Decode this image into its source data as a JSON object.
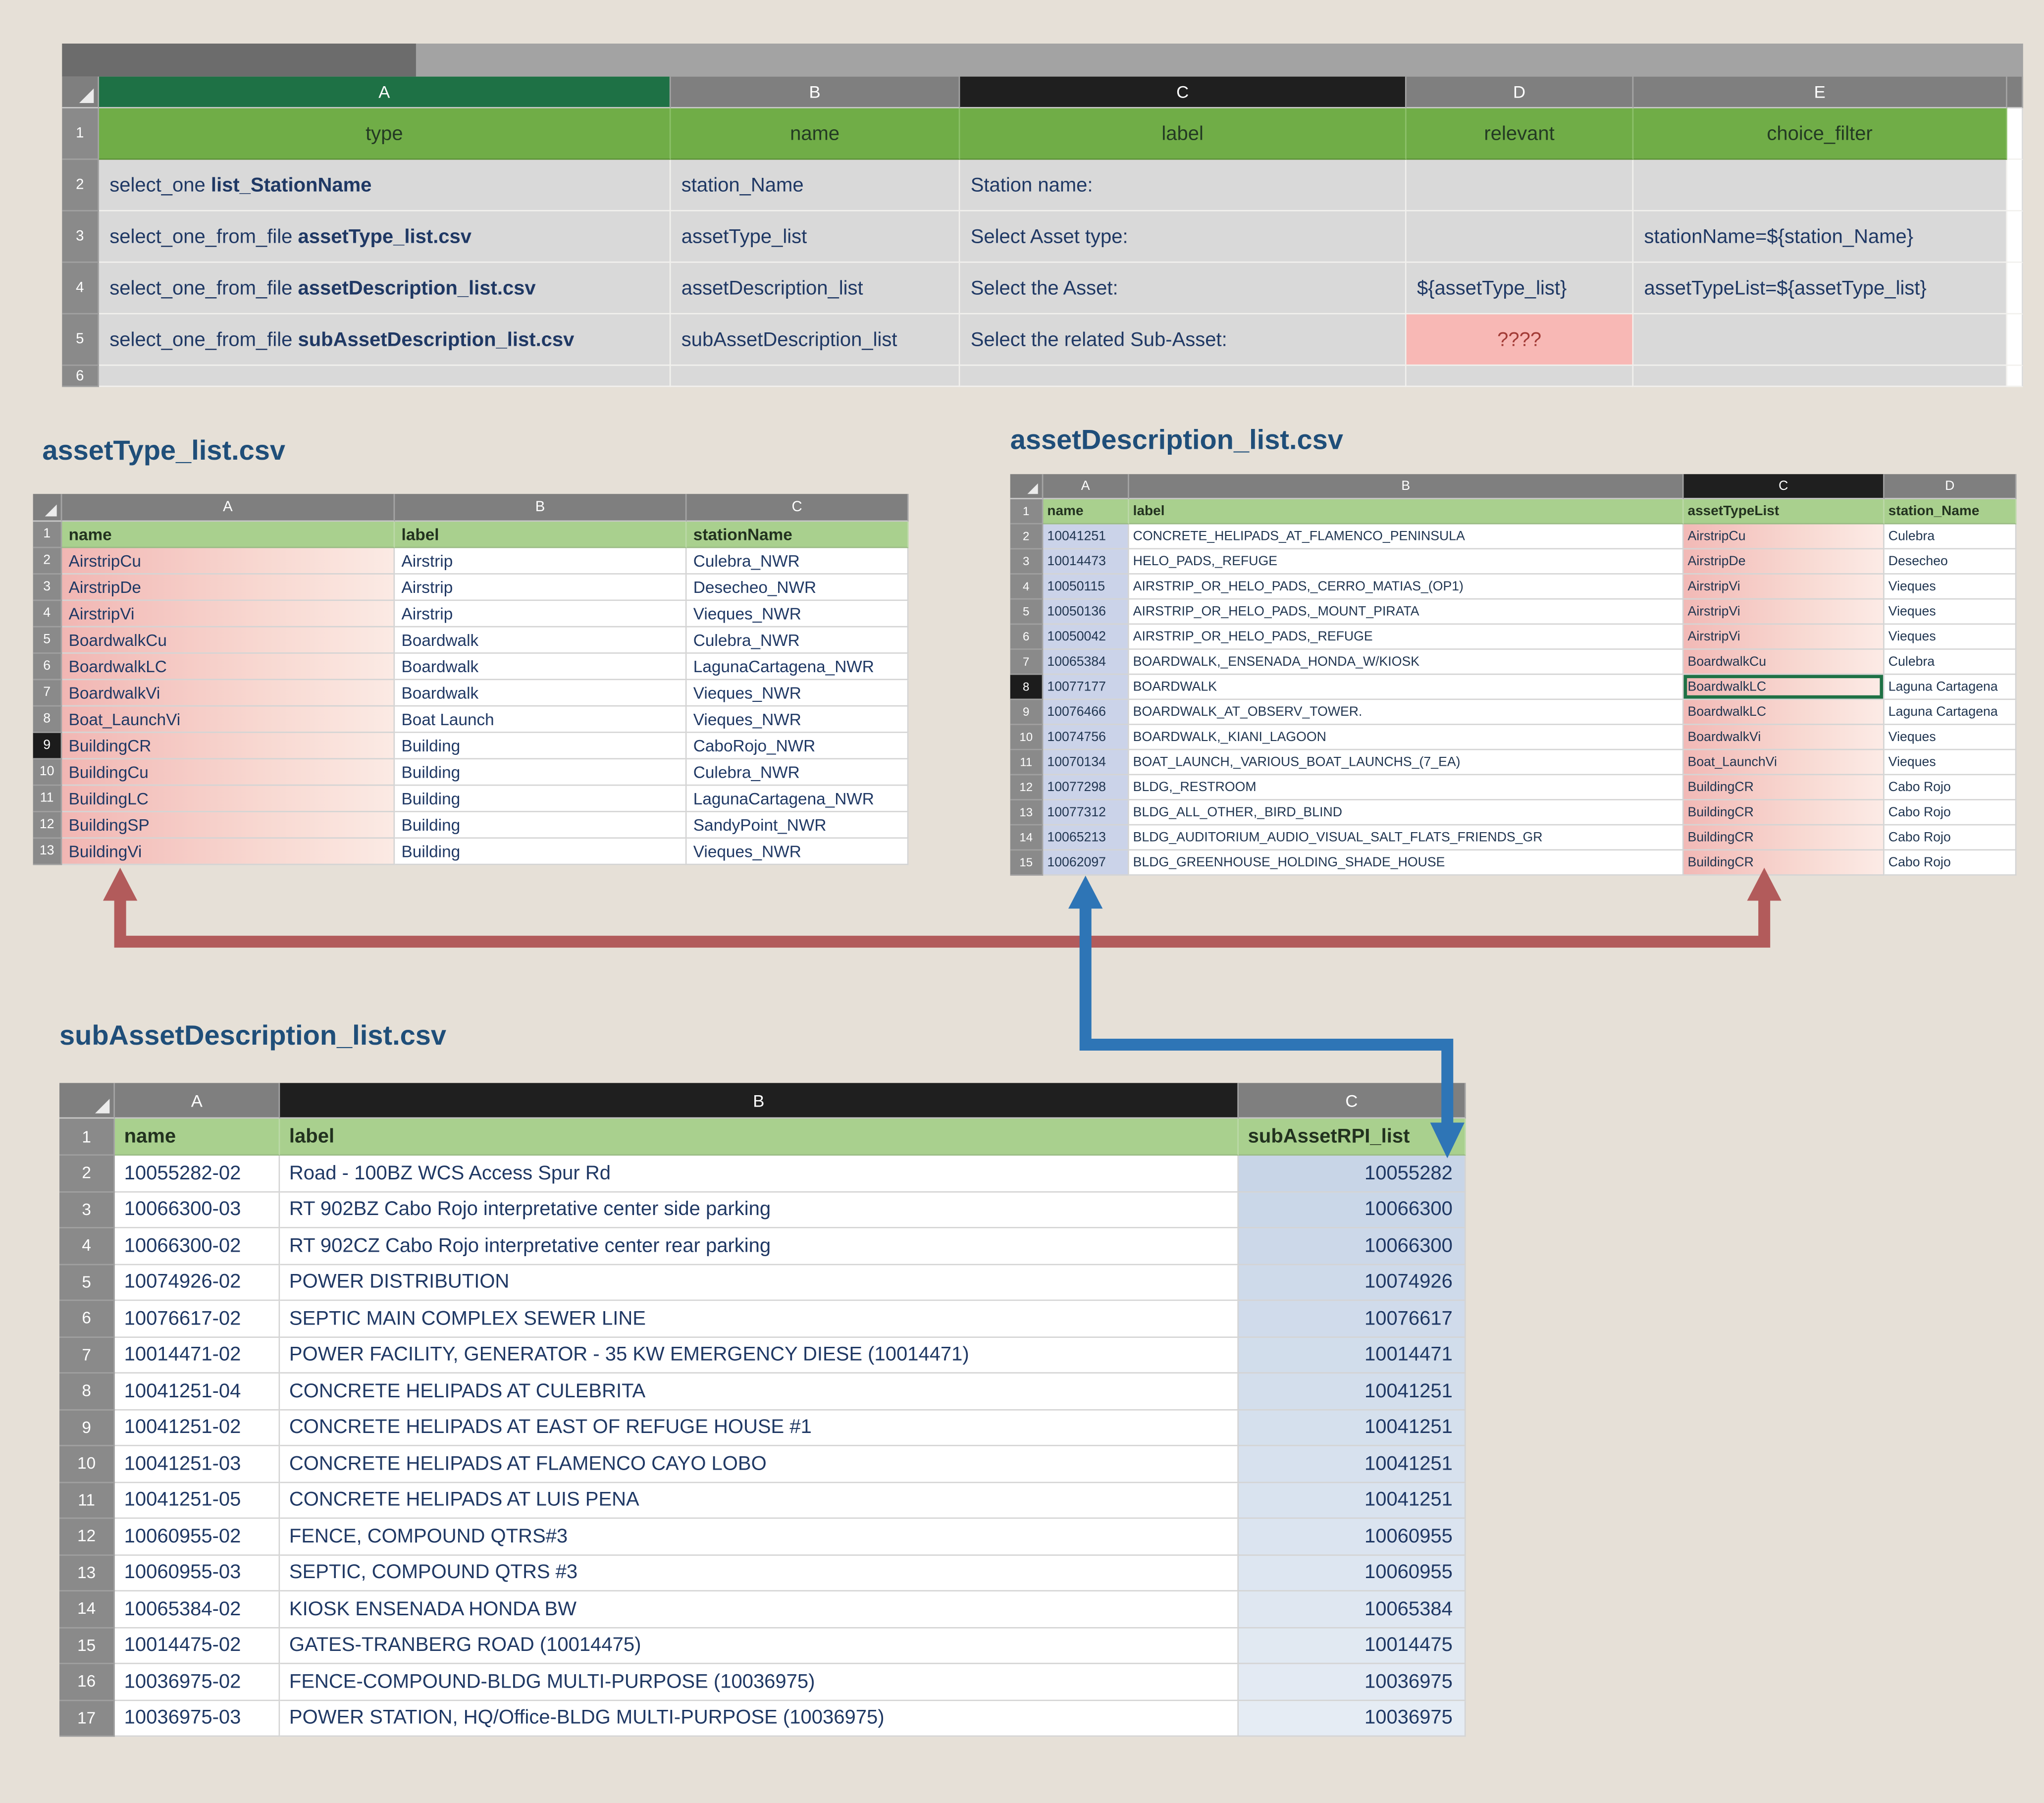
{
  "colors": {
    "survey_header_green": "#70ad47",
    "csv_header_green": "#a9d08e",
    "pink_highlight": "#f2b9b6",
    "lavender_highlight": "#cbd3e9",
    "blue_column_tint": "#ccd6e8",
    "red_arrow": "#b25b5b",
    "blue_arrow": "#2e75b6",
    "error_cell_bg": "#f8b8b5"
  },
  "survey": {
    "column_letters": [
      "A",
      "B",
      "C",
      "D",
      "E"
    ],
    "row1_num": "1",
    "headers": [
      "type",
      "name",
      "label",
      "relevant",
      "choice_filter"
    ],
    "rows": [
      {
        "num": "2",
        "type_prefix": "select_one ",
        "type_file": "list_StationName",
        "name": "station_Name",
        "label": "Station name:",
        "relevant": "",
        "choice_filter": ""
      },
      {
        "num": "3",
        "type_prefix": "select_one_from_file ",
        "type_file": "assetType_list.csv",
        "name": "assetType_list",
        "label": "Select Asset type:",
        "relevant": "",
        "choice_filter": "stationName=${station_Name}"
      },
      {
        "num": "4",
        "type_prefix": "select_one_from_file ",
        "type_file": "assetDescription_list.csv",
        "name": "assetDescription_list",
        "label": "Select the Asset:",
        "relevant": "${assetType_list}",
        "choice_filter": "assetTypeList=${assetType_list}"
      },
      {
        "num": "5",
        "type_prefix": "select_one_from_file ",
        "type_file": "subAssetDescription_list.csv",
        "name": "subAssetDescription_list",
        "label": "Select the related Sub-Asset:",
        "relevant": "????",
        "choice_filter": ""
      }
    ],
    "empty_row_num": "6"
  },
  "asset_type_table": {
    "title": "assetType_list.csv",
    "column_letters": [
      "A",
      "B",
      "C"
    ],
    "row1_num": "1",
    "headers": [
      "name",
      "label",
      "stationName"
    ],
    "selected_row": "9",
    "rows": [
      {
        "num": "2",
        "name": "AirstripCu",
        "label": "Airstrip",
        "station": "Culebra_NWR"
      },
      {
        "num": "3",
        "name": "AirstripDe",
        "label": "Airstrip",
        "station": "Desecheo_NWR"
      },
      {
        "num": "4",
        "name": "AirstripVi",
        "label": "Airstrip",
        "station": "Vieques_NWR"
      },
      {
        "num": "5",
        "name": "BoardwalkCu",
        "label": "Boardwalk",
        "station": "Culebra_NWR"
      },
      {
        "num": "6",
        "name": "BoardwalkLC",
        "label": "Boardwalk",
        "station": "LagunaCartagena_NWR"
      },
      {
        "num": "7",
        "name": "BoardwalkVi",
        "label": "Boardwalk",
        "station": "Vieques_NWR"
      },
      {
        "num": "8",
        "name": "Boat_LaunchVi",
        "label": "Boat Launch",
        "station": "Vieques_NWR"
      },
      {
        "num": "9",
        "name": "BuildingCR",
        "label": "Building",
        "station": "CaboRojo_NWR"
      },
      {
        "num": "10",
        "name": "BuildingCu",
        "label": "Building",
        "station": "Culebra_NWR"
      },
      {
        "num": "11",
        "name": "BuildingLC",
        "label": "Building",
        "station": "LagunaCartagena_NWR"
      },
      {
        "num": "12",
        "name": "BuildingSP",
        "label": "Building",
        "station": "SandyPoint_NWR"
      },
      {
        "num": "13",
        "name": "BuildingVi",
        "label": "Building",
        "station": "Vieques_NWR"
      }
    ]
  },
  "asset_description_table": {
    "title": "assetDescription_list.csv",
    "column_letters": [
      "A",
      "B",
      "C",
      "D"
    ],
    "row1_num": "1",
    "headers": [
      "name",
      "label",
      "assetTypeList",
      "station_Name"
    ],
    "selected_row": "8",
    "active_cell": "C8",
    "rows": [
      {
        "num": "2",
        "name": "10041251",
        "label": "CONCRETE_HELIPADS_AT_FLAMENCO_PENINSULA",
        "asset_type": "AirstripCu",
        "station": "Culebra"
      },
      {
        "num": "3",
        "name": "10014473",
        "label": "HELO_PADS,_REFUGE",
        "asset_type": "AirstripDe",
        "station": "Desecheo"
      },
      {
        "num": "4",
        "name": "10050115",
        "label": "AIRSTRIP_OR_HELO_PADS,_CERRO_MATIAS_(OP1)",
        "asset_type": "AirstripVi",
        "station": "Vieques"
      },
      {
        "num": "5",
        "name": "10050136",
        "label": "AIRSTRIP_OR_HELO_PADS,_MOUNT_PIRATA",
        "asset_type": "AirstripVi",
        "station": "Vieques"
      },
      {
        "num": "6",
        "name": "10050042",
        "label": "AIRSTRIP_OR_HELO_PADS,_REFUGE",
        "asset_type": "AirstripVi",
        "station": "Vieques"
      },
      {
        "num": "7",
        "name": "10065384",
        "label": "BOARDWALK,_ENSENADA_HONDA_W/KIOSK",
        "asset_type": "BoardwalkCu",
        "station": "Culebra"
      },
      {
        "num": "8",
        "name": "10077177",
        "label": "BOARDWALK",
        "asset_type": "BoardwalkLC",
        "station": "Laguna Cartagena"
      },
      {
        "num": "9",
        "name": "10076466",
        "label": "BOARDWALK_AT_OBSERV_TOWER.",
        "asset_type": "BoardwalkLC",
        "station": "Laguna Cartagena"
      },
      {
        "num": "10",
        "name": "10074756",
        "label": "BOARDWALK,_KIANI_LAGOON",
        "asset_type": "BoardwalkVi",
        "station": "Vieques"
      },
      {
        "num": "11",
        "name": "10070134",
        "label": "BOAT_LAUNCH,_VARIOUS_BOAT_LAUNCHS_(7_EA)",
        "asset_type": "Boat_LaunchVi",
        "station": "Vieques"
      },
      {
        "num": "12",
        "name": "10077298",
        "label": "BLDG,_RESTROOM",
        "asset_type": "BuildingCR",
        "station": "Cabo Rojo"
      },
      {
        "num": "13",
        "name": "10077312",
        "label": "BLDG_ALL_OTHER,_BIRD_BLIND",
        "asset_type": "BuildingCR",
        "station": "Cabo Rojo"
      },
      {
        "num": "14",
        "name": "10065213",
        "label": "BLDG_AUDITORIUM_AUDIO_VISUAL_SALT_FLATS_FRIENDS_GR",
        "asset_type": "BuildingCR",
        "station": "Cabo Rojo"
      },
      {
        "num": "15",
        "name": "10062097",
        "label": "BLDG_GREENHOUSE_HOLDING_SHADE_HOUSE",
        "asset_type": "BuildingCR",
        "station": "Cabo Rojo"
      }
    ]
  },
  "sub_asset_table": {
    "title": "subAssetDescription_list.csv",
    "column_letters": [
      "A",
      "B",
      "C"
    ],
    "row1_num": "1",
    "headers": [
      "name",
      "label",
      "subAssetRPI_list"
    ],
    "rows": [
      {
        "num": "2",
        "name": "10055282-02",
        "label": "Road - 100BZ WCS Access Spur Rd",
        "rpi": "10055282"
      },
      {
        "num": "3",
        "name": "10066300-03",
        "label": "RT 902BZ Cabo Rojo interpretative center side parking",
        "rpi": "10066300"
      },
      {
        "num": "4",
        "name": "10066300-02",
        "label": "RT 902CZ Cabo Rojo interpretative center rear parking",
        "rpi": "10066300"
      },
      {
        "num": "5",
        "name": "10074926-02",
        "label": "POWER DISTRIBUTION",
        "rpi": "10074926"
      },
      {
        "num": "6",
        "name": "10076617-02",
        "label": "SEPTIC MAIN COMPLEX SEWER LINE",
        "rpi": "10076617"
      },
      {
        "num": "7",
        "name": "10014471-02",
        "label": "POWER FACILITY, GENERATOR - 35 KW EMERGENCY DIESE (10014471)",
        "rpi": "10014471"
      },
      {
        "num": "8",
        "name": "10041251-04",
        "label": "CONCRETE HELIPADS AT CULEBRITA",
        "rpi": "10041251"
      },
      {
        "num": "9",
        "name": "10041251-02",
        "label": "CONCRETE HELIPADS AT EAST OF REFUGE HOUSE #1",
        "rpi": "10041251"
      },
      {
        "num": "10",
        "name": "10041251-03",
        "label": "CONCRETE HELIPADS AT FLAMENCO CAYO LOBO",
        "rpi": "10041251"
      },
      {
        "num": "11",
        "name": "10041251-05",
        "label": "CONCRETE HELIPADS AT LUIS PENA",
        "rpi": "10041251"
      },
      {
        "num": "12",
        "name": "10060955-02",
        "label": "FENCE, COMPOUND QTRS#3",
        "rpi": "10060955"
      },
      {
        "num": "13",
        "name": "10060955-03",
        "label": "SEPTIC, COMPOUND QTRS #3",
        "rpi": "10060955"
      },
      {
        "num": "14",
        "name": "10065384-02",
        "label": "KIOSK ENSENADA HONDA BW",
        "rpi": "10065384"
      },
      {
        "num": "15",
        "name": "10014475-02",
        "label": "GATES-TRANBERG ROAD (10014475)",
        "rpi": "10014475"
      },
      {
        "num": "16",
        "name": "10036975-02",
        "label": "FENCE-COMPOUND-BLDG MULTI-PURPOSE (10036975)",
        "rpi": "10036975"
      },
      {
        "num": "17",
        "name": "10036975-03",
        "label": "POWER STATION, HQ/Office-BLDG MULTI-PURPOSE (10036975)",
        "rpi": "10036975"
      }
    ]
  }
}
